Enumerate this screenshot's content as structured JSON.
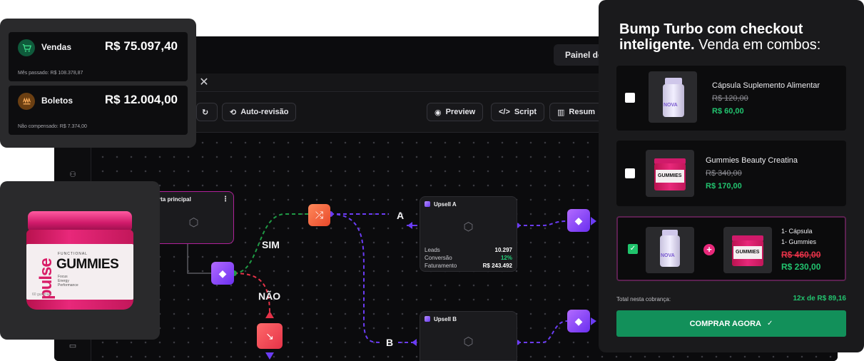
{
  "app": {
    "panel_button": "Painel do c",
    "toolbar": {
      "auto_revisao": "Auto-revisão",
      "preview": "Preview",
      "script": "Script",
      "resumo": "Resum"
    },
    "flow": {
      "main_node_title": "rta principal",
      "upsell_a": {
        "title": "Upsell A",
        "stats": [
          {
            "label": "Leads",
            "value": "10.297"
          },
          {
            "label": "Conversão",
            "value": "12%"
          },
          {
            "label": "Faturamento",
            "value": "R$ 243.492"
          }
        ]
      },
      "upsell_b": {
        "title": "Upsell B"
      },
      "labels": {
        "sim": "SIM",
        "nao": "NÃO",
        "a": "A",
        "b": "B"
      }
    }
  },
  "stats_card": {
    "vendas": {
      "title": "Vendas",
      "value": "R$ 75.097,40",
      "sub": "Mês passado: R$ 108.378,87"
    },
    "boletos": {
      "title": "Boletos",
      "value": "R$ 12.004,00",
      "sub": "Não compensado: R$ 7.374,00"
    }
  },
  "product": {
    "brand": "pulse",
    "kicker": "FUNCTIONAL",
    "name": "GUMMIES",
    "bullets": [
      "Focus",
      "Energy",
      "Performance"
    ],
    "footer": "60 gummies"
  },
  "checkout": {
    "title_bold": "Bump Turbo com checkout inteligente.",
    "title_rest": " Venda em combos:",
    "offers": [
      {
        "name": "Cápsula Suplemento Alimentar",
        "old_price": "R$ 120,00",
        "new_price": "R$ 60,00",
        "checked": false
      },
      {
        "name": "Gummies Beauty Creatina",
        "old_price": "R$ 340,00",
        "new_price": "R$ 170,00",
        "checked": false
      },
      {
        "name_lines": [
          "1- Cápsula",
          "1- Gummies"
        ],
        "old_price": "R$ 460,00",
        "new_price": "R$ 230,00",
        "checked": true
      }
    ],
    "jar_labels": {
      "nova": "NOVA",
      "gummies": "GUMMIES"
    },
    "total_label": "Total nesta cobrança:",
    "total_value": "12x de R$ 89,16",
    "buy_button": "COMPRAR AGORA"
  },
  "colors": {
    "accent_purple": "#7c3cff",
    "accent_green": "#22c46f",
    "accent_red": "#e53248",
    "buy_button": "#12905a",
    "flow_green": "#1f9a45"
  }
}
